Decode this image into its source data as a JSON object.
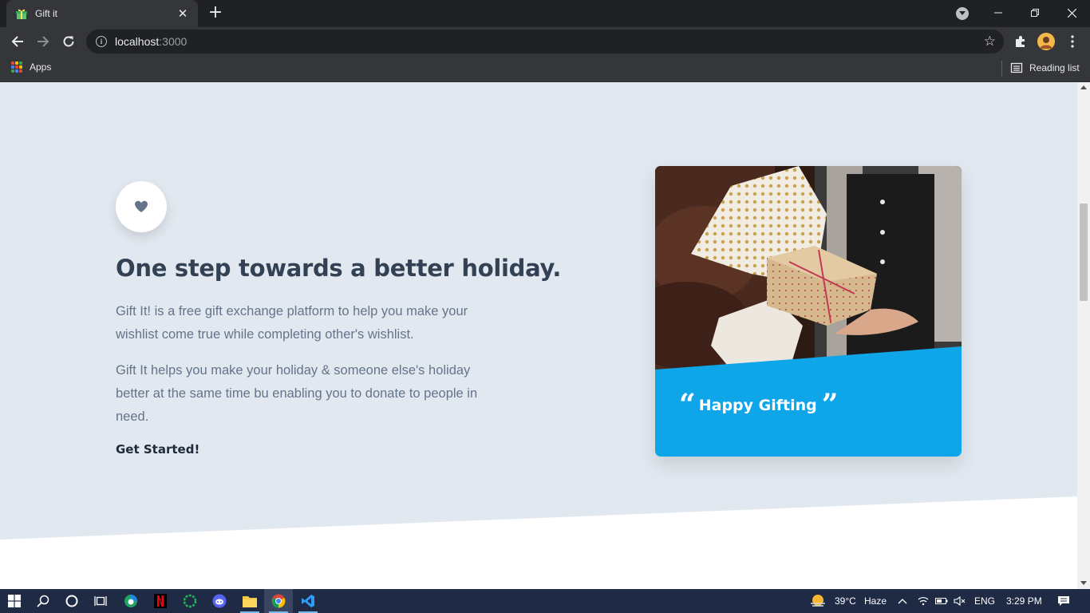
{
  "browser": {
    "tab": {
      "title": "Gift it"
    },
    "address": {
      "host": "localhost",
      "port": ":3000"
    },
    "bookmarks": {
      "apps_label": "Apps",
      "reading_list_label": "Reading list"
    }
  },
  "page": {
    "heading": "One step towards a better holiday.",
    "paragraph1": "Gift It! is a free gift exchange platform to help you make your wishlist come true while completing other's wishlist.",
    "paragraph2": "Gift It helps you make your holiday & someone else's holiday better at the same time bu enabling you to donate to people in need.",
    "cta": "Get Started!",
    "card": {
      "quote_open": "“",
      "quote_text": "Happy Gifting",
      "quote_close": "”"
    },
    "colors": {
      "section_bg": "#e2e8f0",
      "card_accent": "#0ea5e9",
      "heading": "#334155",
      "body_text": "#64748b"
    }
  },
  "taskbar": {
    "weather_temp": "39°C",
    "weather_desc": "Haze",
    "language": "ENG",
    "time": "3:29 PM"
  }
}
